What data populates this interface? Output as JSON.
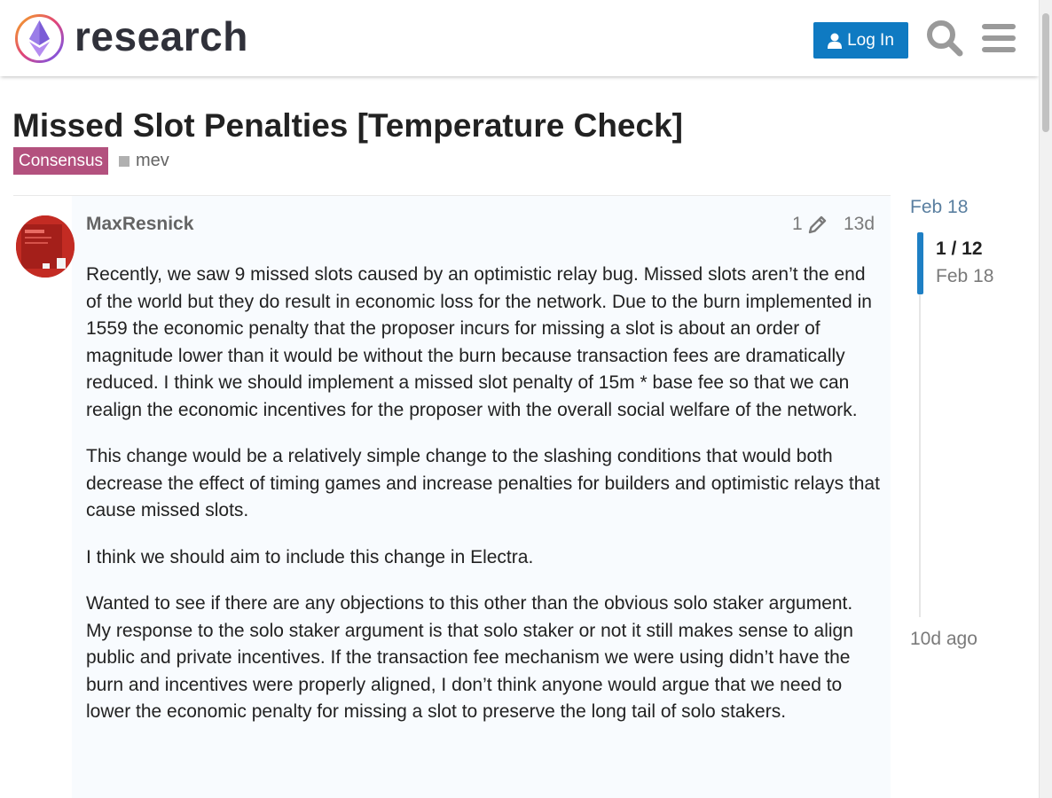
{
  "header": {
    "site_name": "research",
    "login_label": "Log In"
  },
  "topic": {
    "title": "Missed Slot Penalties [Temperature Check]",
    "category": "Consensus",
    "category_color": "#b3517e",
    "tags": [
      "mev"
    ]
  },
  "post": {
    "author": "MaxResnick",
    "edit_count": "1",
    "age": "13d",
    "paragraphs": [
      "Recently, we saw 9 missed slots caused by an optimistic relay bug. Missed slots aren’t the end of the world but they do result in economic loss for the network. Due to the burn implemented in 1559 the economic penalty that the proposer incurs for missing a slot is about an order of magnitude lower than it would be without the burn because transaction fees are dramatically reduced. I think we should implement a missed slot penalty of 15m * base fee so that we can realign the economic incentives for the proposer with the overall social welfare of the network.",
      "This change would be a relatively simple change to the slashing conditions that would both decrease the effect of timing games and increase penalties for builders and optimistic relays that cause missed slots.",
      "I think we should aim to include this change in Electra.",
      "Wanted to see if there are any objections to this other than the obvious solo staker argument. My response to the solo staker argument is that solo staker or not it still makes sense to align public and private incentives. If the transaction fee mechanism we were using didn’t have the burn and incentives were properly aligned, I don’t think anyone would argue that we need to lower the economic penalty for missing a slot to preserve the long tail of solo stakers."
    ]
  },
  "timeline": {
    "start_date": "Feb 18",
    "position": "1 / 12",
    "position_date": "Feb 18",
    "end_label": "10d ago"
  },
  "colors": {
    "accent": "#0f7ac2",
    "timeline_handle": "#1e7fc4"
  },
  "icons": [
    "site-logo-icon",
    "user-icon",
    "search-icon",
    "hamburger-menu-icon",
    "pencil-icon",
    "tag-square-icon"
  ]
}
